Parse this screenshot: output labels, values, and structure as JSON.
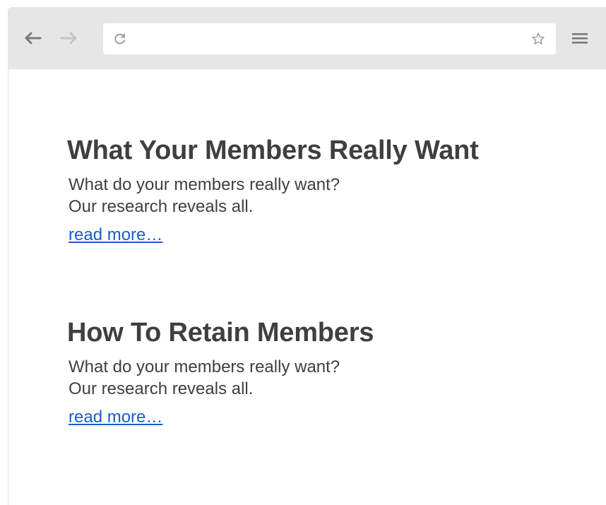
{
  "browser": {
    "address_value": "",
    "icons": {
      "back": "back-arrow-icon",
      "forward": "forward-arrow-icon",
      "reload": "reload-icon",
      "star": "star-icon",
      "menu": "hamburger-menu-icon"
    }
  },
  "articles": [
    {
      "title": "What Your Members Really Want",
      "line1": "What do your members really want?",
      "line2": "Our research reveals all.",
      "link": "read more…"
    },
    {
      "title": "How To Retain Members",
      "line1": "What do your members really want?",
      "line2": "Our research reveals all.",
      "link": "read more…"
    }
  ],
  "colors": {
    "toolbar": "#e6e6e6",
    "text": "#3f3f3f",
    "link": "#1a5ec4"
  }
}
